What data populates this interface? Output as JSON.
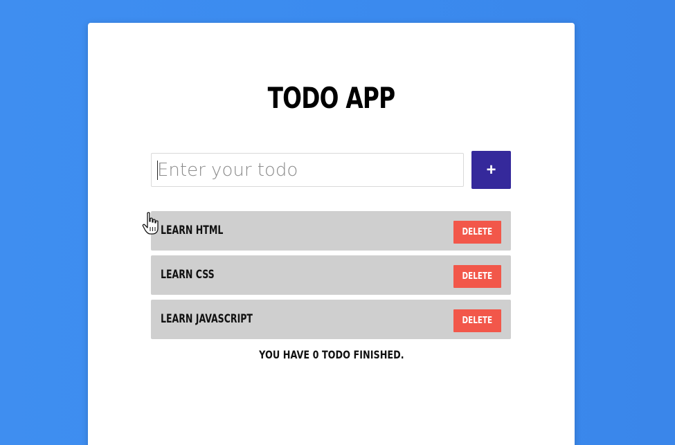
{
  "app": {
    "title": "TODO APP"
  },
  "input": {
    "placeholder": "Enter your todo",
    "value": ""
  },
  "add_button": {
    "label": "+"
  },
  "todos": [
    {
      "text": "LEARN HTML",
      "delete_label": "DELETE"
    },
    {
      "text": "LEARN CSS",
      "delete_label": "DELETE"
    },
    {
      "text": "LEARN JAVASCRIPT",
      "delete_label": "DELETE"
    }
  ],
  "status": {
    "text": "YOU HAVE 0 TODO FINISHED."
  },
  "colors": {
    "background": "#3b8bef",
    "card": "#ffffff",
    "add_button": "#35299b",
    "delete_button": "#f2574a",
    "todo_item": "#cfcfcf"
  },
  "icons": {
    "cursor": "hand-pointer-icon"
  }
}
